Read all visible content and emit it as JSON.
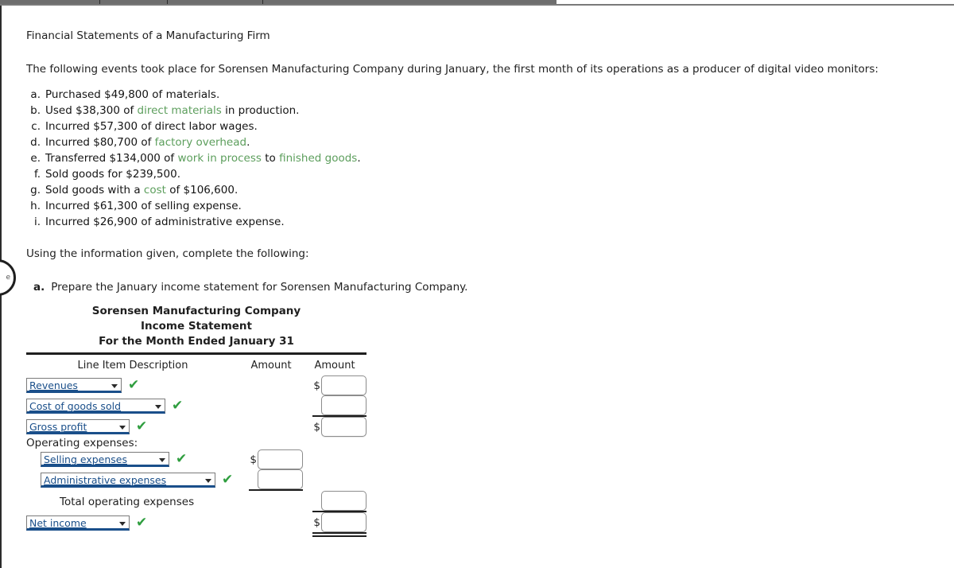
{
  "browser": {
    "tab_strip_present": true,
    "tab_divider_positions": [
      125,
      210,
      330
    ]
  },
  "marker_badge": {
    "label": "e"
  },
  "document": {
    "title": "Financial Statements of a Manufacturing Firm",
    "intro": "The following events took place for Sorensen Manufacturing Company during January, the first month of its operations as a producer of digital video monitors:",
    "events": [
      {
        "marker": "a.",
        "parts": [
          {
            "text": "Purchased $49,800 of materials.",
            "style": "plain"
          }
        ]
      },
      {
        "marker": "b.",
        "parts": [
          {
            "text": "Used $38,300 of ",
            "style": "plain"
          },
          {
            "text": "direct materials",
            "style": "green"
          },
          {
            "text": " in production.",
            "style": "plain"
          }
        ]
      },
      {
        "marker": "c.",
        "parts": [
          {
            "text": "Incurred $57,300 of direct labor wages.",
            "style": "plain"
          }
        ]
      },
      {
        "marker": "d.",
        "parts": [
          {
            "text": "Incurred $80,700 of ",
            "style": "plain"
          },
          {
            "text": "factory overhead",
            "style": "green"
          },
          {
            "text": ".",
            "style": "plain"
          }
        ]
      },
      {
        "marker": "e.",
        "parts": [
          {
            "text": "Transferred $134,000 of ",
            "style": "plain"
          },
          {
            "text": "work in process",
            "style": "green"
          },
          {
            "text": " to ",
            "style": "plain"
          },
          {
            "text": "finished goods",
            "style": "green"
          },
          {
            "text": ".",
            "style": "plain"
          }
        ]
      },
      {
        "marker": "f.",
        "parts": [
          {
            "text": "Sold goods for $239,500.",
            "style": "plain"
          }
        ]
      },
      {
        "marker": "g.",
        "parts": [
          {
            "text": "Sold goods with a ",
            "style": "plain"
          },
          {
            "text": "cost",
            "style": "green"
          },
          {
            "text": " of $106,600.",
            "style": "plain"
          }
        ]
      },
      {
        "marker": "h.",
        "parts": [
          {
            "text": "Incurred $61,300 of selling expense.",
            "style": "plain"
          }
        ]
      },
      {
        "marker": "i.",
        "parts": [
          {
            "text": "Incurred $26,900 of administrative expense.",
            "style": "plain"
          }
        ]
      }
    ],
    "using_line": "Using the information given, complete the following:",
    "part_a": {
      "label": "a.",
      "text": "Prepare the January income statement for Sorensen Manufacturing Company."
    }
  },
  "statement": {
    "heading_company": "Sorensen Manufacturing Company",
    "heading_title": "Income Statement",
    "heading_period": "For the Month Ended January 31",
    "columns": {
      "description": "Line Item Description",
      "amount1": "Amount",
      "amount2": "Amount"
    },
    "rows": [
      {
        "type": "select",
        "label": "Revenues",
        "width": "w1",
        "indent": 0,
        "check": true,
        "col": 2,
        "dollar": true,
        "value": "",
        "rule": "none"
      },
      {
        "type": "select",
        "label": "Cost of goods sold",
        "width": "w2",
        "indent": 0,
        "check": true,
        "col": 2,
        "dollar": false,
        "value": "",
        "rule": "single"
      },
      {
        "type": "select",
        "label": "Gross profit",
        "width": "w3",
        "indent": 0,
        "check": true,
        "col": 2,
        "dollar": true,
        "value": "",
        "rule": "none"
      },
      {
        "type": "text",
        "label": "Operating expenses:",
        "indent": 0,
        "check": false,
        "col": 0,
        "dollar": false,
        "value": "",
        "rule": "none"
      },
      {
        "type": "select",
        "label": "Selling expenses",
        "width": "w4",
        "indent": 1,
        "check": true,
        "col": 1,
        "dollar": true,
        "value": "",
        "rule": "none"
      },
      {
        "type": "select",
        "label": "Administrative expenses",
        "width": "w5",
        "indent": 1,
        "check": true,
        "col": 1,
        "dollar": false,
        "value": "",
        "rule": "single"
      },
      {
        "type": "text",
        "label": "Total operating expenses",
        "indent": 2,
        "check": false,
        "col": 2,
        "dollar": false,
        "value": "",
        "rule": "single"
      },
      {
        "type": "select",
        "label": "Net income",
        "width": "w6",
        "indent": 0,
        "check": true,
        "col": 2,
        "dollar": true,
        "value": "",
        "rule": "double"
      }
    ],
    "input_placeholder": ""
  },
  "icons": {
    "checkmark": "✔",
    "dropdown_arrow": "▼",
    "dollar_sign": "$"
  },
  "colors": {
    "link_green": "#5c9e5c",
    "check_green": "#2f9e3f",
    "select_blue": "#1a4f8a",
    "rule_black": "#1f1f1f"
  }
}
